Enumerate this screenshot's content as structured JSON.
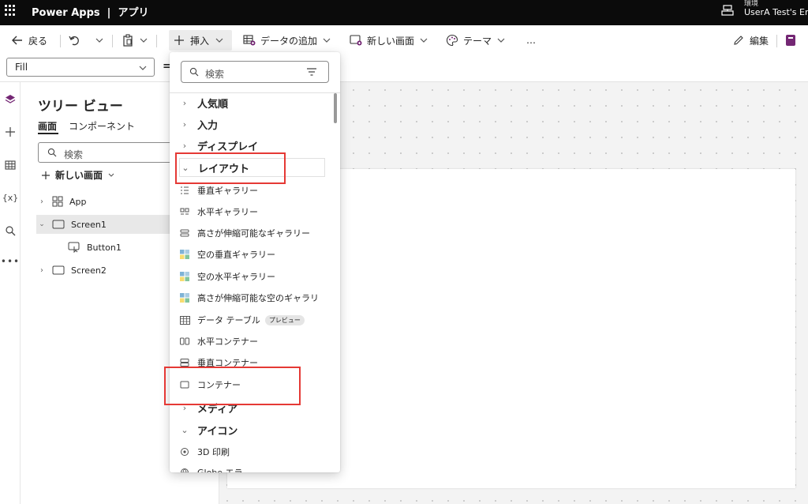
{
  "header": {
    "app_title": "Power Apps  |  アプリ",
    "env_label": "環境",
    "env_name": "UserA Test's En"
  },
  "commandbar": {
    "back": "戻る",
    "insert": "挿入",
    "add_data": "データの追加",
    "new_screen": "新しい画面",
    "theme": "テーマ",
    "more": "…",
    "edit": "編集"
  },
  "formulabar": {
    "property": "Fill",
    "equals": "="
  },
  "tree": {
    "title": "ツリー ビュー",
    "tab_screens": "画面",
    "tab_components": "コンポーネント",
    "search_placeholder": "検索",
    "new_screen": "新しい画面",
    "items": [
      {
        "label": "App"
      },
      {
        "label": "Screen1"
      },
      {
        "label": "Button1"
      },
      {
        "label": "Screen2"
      }
    ]
  },
  "insert_pane": {
    "search_placeholder": "検索",
    "categories": [
      {
        "label": "人気順"
      },
      {
        "label": "入力"
      },
      {
        "label": "ディスプレイ"
      },
      {
        "label": "レイアウト"
      },
      {
        "label": "メディア"
      },
      {
        "label": "アイコン"
      }
    ],
    "layout_items": [
      {
        "label": "垂直ギャラリー"
      },
      {
        "label": "水平ギャラリー"
      },
      {
        "label": "高さが伸縮可能なギャラリー"
      },
      {
        "label": "空の垂直ギャラリー"
      },
      {
        "label": "空の水平ギャラリー"
      },
      {
        "label": "高さが伸縮可能な空のギャラリ"
      },
      {
        "label": "データ テーブル",
        "badge": "プレビュー"
      },
      {
        "label": "水平コンテナー"
      },
      {
        "label": "垂直コンテナー"
      },
      {
        "label": "コンテナー"
      }
    ],
    "icon_items": [
      {
        "label": "3D 印刷"
      },
      {
        "label": "Globe  エラ"
      }
    ]
  },
  "colors": {
    "header_bg": "#0b0b0b",
    "accent": "#742774",
    "highlight": "#e53935"
  }
}
